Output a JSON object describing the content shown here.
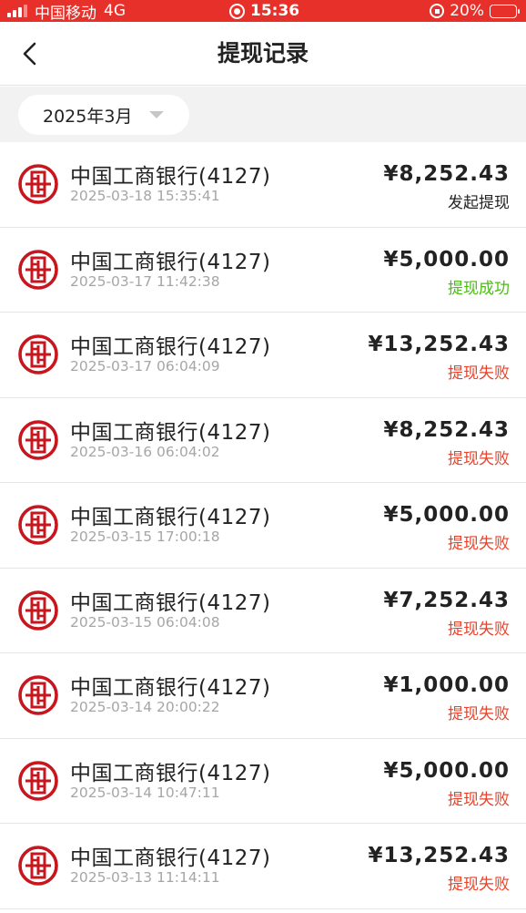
{
  "status_bar": {
    "carrier": "中国移动",
    "network": "4G",
    "time": "15:36",
    "battery": "20%"
  },
  "nav": {
    "title": "提现记录",
    "back_icon": "chevron-left-icon"
  },
  "filter": {
    "month": "2025年3月",
    "caret_icon": "caret-down-icon"
  },
  "colors": {
    "brand_red": "#e8302a",
    "icbc_red": "#c7161e",
    "status_initiated": "#222222",
    "status_success": "#4cbb17",
    "status_failed": "#e8432a"
  },
  "records": [
    {
      "bank": "中国工商银行(4127)",
      "time": "2025-03-18 15:35:41",
      "amount": "¥8,252.43",
      "status": "发起提现",
      "status_type": "initiated"
    },
    {
      "bank": "中国工商银行(4127)",
      "time": "2025-03-17 11:42:38",
      "amount": "¥5,000.00",
      "status": "提现成功",
      "status_type": "success"
    },
    {
      "bank": "中国工商银行(4127)",
      "time": "2025-03-17 06:04:09",
      "amount": "¥13,252.43",
      "status": "提现失败",
      "status_type": "failed"
    },
    {
      "bank": "中国工商银行(4127)",
      "time": "2025-03-16 06:04:02",
      "amount": "¥8,252.43",
      "status": "提现失败",
      "status_type": "failed"
    },
    {
      "bank": "中国工商银行(4127)",
      "time": "2025-03-15 17:00:18",
      "amount": "¥5,000.00",
      "status": "提现失败",
      "status_type": "failed"
    },
    {
      "bank": "中国工商银行(4127)",
      "time": "2025-03-15 06:04:08",
      "amount": "¥7,252.43",
      "status": "提现失败",
      "status_type": "failed"
    },
    {
      "bank": "中国工商银行(4127)",
      "time": "2025-03-14 20:00:22",
      "amount": "¥1,000.00",
      "status": "提现失败",
      "status_type": "failed"
    },
    {
      "bank": "中国工商银行(4127)",
      "time": "2025-03-14 10:47:11",
      "amount": "¥5,000.00",
      "status": "提现失败",
      "status_type": "failed"
    },
    {
      "bank": "中国工商银行(4127)",
      "time": "2025-03-13 11:14:11",
      "amount": "¥13,252.43",
      "status": "提现失败",
      "status_type": "failed"
    }
  ]
}
